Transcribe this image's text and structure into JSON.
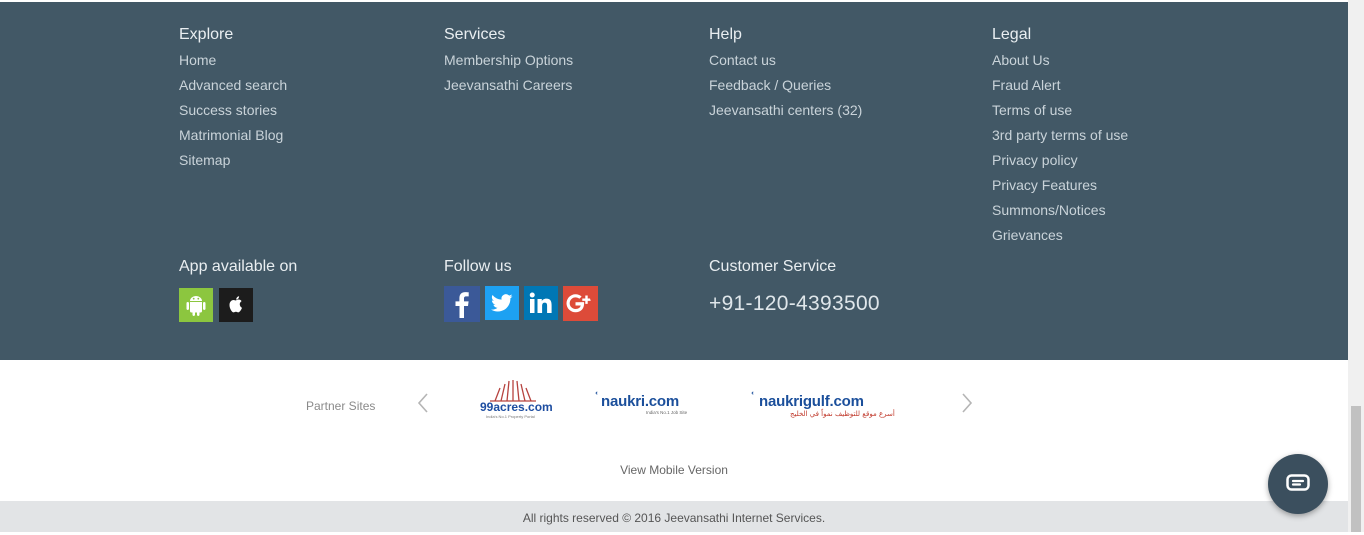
{
  "explore": {
    "title": "Explore",
    "links": [
      "Home",
      "Advanced search",
      "Success stories",
      "Matrimonial Blog",
      "Sitemap"
    ]
  },
  "services": {
    "title": "Services",
    "links": [
      "Membership Options",
      "Jeevansathi Careers"
    ]
  },
  "help": {
    "title": "Help",
    "links": [
      "Contact us",
      "Feedback / Queries",
      "Jeevansathi centers (32)"
    ]
  },
  "legal": {
    "title": "Legal",
    "links": [
      "About Us",
      "Fraud Alert",
      "Terms of use",
      "3rd party terms of use",
      "Privacy policy",
      "Privacy Features",
      "Summons/Notices",
      "Grievances"
    ]
  },
  "app": {
    "title": "App available on",
    "icons": [
      "android-icon",
      "apple-icon"
    ]
  },
  "follow": {
    "title": "Follow us",
    "icons": [
      "facebook-icon",
      "twitter-icon",
      "linkedin-icon",
      "google-plus-icon"
    ]
  },
  "customer_service": {
    "title": "Customer Service",
    "phone": "+91-120-4393500"
  },
  "partners": {
    "label": "Partner Sites",
    "sites": [
      {
        "name": "99acres.com",
        "tagline": "India's No.1 Property Portal"
      },
      {
        "name": "naukri.com",
        "tagline": "India's No.1 Job Site"
      },
      {
        "name": "naukrigulf.com",
        "tagline": "أسرع موقع للتوظيف نمواً في الخليج"
      }
    ]
  },
  "mobile_link": "View Mobile Version",
  "copyright": "All rights reserved © 2016 Jeevansathi Internet Services.",
  "colors": {
    "footer_bg": "#425866",
    "bottom_bar_bg": "#e2e4e6",
    "android_green": "#8cc63f",
    "facebook_blue": "#3b5998",
    "twitter_blue": "#1da1f2",
    "linkedin_blue": "#0077b5",
    "google_red": "#dd4b39",
    "naukri_blue": "#1b4f9b"
  }
}
